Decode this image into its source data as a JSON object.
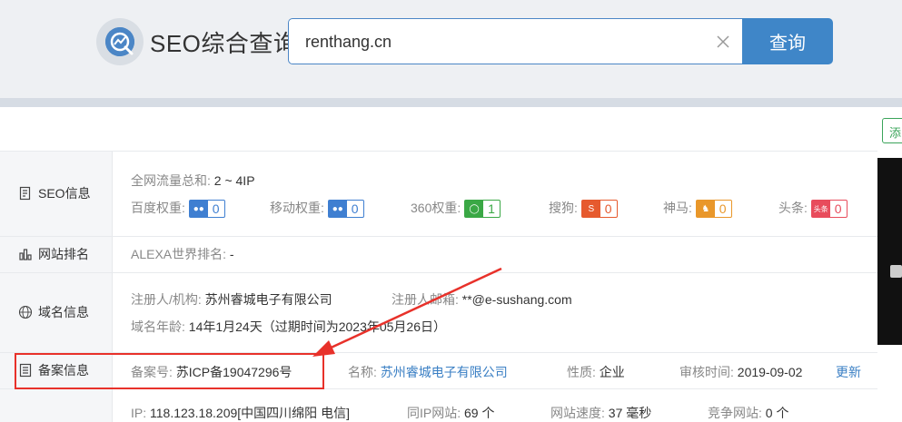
{
  "header": {
    "brand": "SEO综合查询",
    "search_value": "renthang.cn",
    "search_button": "查询"
  },
  "panel": {
    "add_label": "添"
  },
  "sidebar": {
    "seo": "SEO信息",
    "rank": "网站排名",
    "domain": "域名信息",
    "icp": "备案信息"
  },
  "seo": {
    "traffic_label": "全网流量总和:",
    "traffic_value": "2 ~ 4IP",
    "weights": [
      {
        "label": "百度权重:",
        "value": "0",
        "color": "#3f7fd1",
        "icon": "baidu-paw-icon"
      },
      {
        "label": "移动权重:",
        "value": "0",
        "color": "#3f7fd1",
        "icon": "mobile-paw-icon"
      },
      {
        "label": "360权重:",
        "value": "1",
        "color": "#3aa845",
        "icon": "360-icon"
      },
      {
        "label": "搜狗:",
        "value": "0",
        "color": "#e65a2e",
        "icon": "sogou-icon"
      },
      {
        "label": "神马:",
        "value": "0",
        "color": "#e9972a",
        "icon": "shenma-icon"
      },
      {
        "label": "头条:",
        "value": "0",
        "color": "#e84c5c",
        "icon": "toutiao-icon"
      }
    ],
    "toutiao_icon_text": "头条"
  },
  "rank": {
    "alexa_label": "ALEXA世界排名:",
    "alexa_value": "-"
  },
  "domain": {
    "registrant_label": "注册人/机构:",
    "registrant_value": "苏州睿城电子有限公司",
    "email_label": "注册人邮箱:",
    "email_value": "**@e-sushang.com",
    "age_label": "域名年龄:",
    "age_value": "14年1月24天（过期时间为2023年05月26日）"
  },
  "icp": {
    "number_label": "备案号:",
    "number_value": "苏ICP备19047296号",
    "name_label": "名称:",
    "name_value": "苏州睿城电子有限公司",
    "nature_label": "性质:",
    "nature_value": "企业",
    "review_label": "审核时间:",
    "review_value": "2019-09-02",
    "update_label": "更新"
  },
  "ip": {
    "ip_label": "IP:",
    "ip_value": "118.123.18.209[中国四川绵阳 电信]",
    "same_ip_label": "同IP网站:",
    "same_ip_value": "69 个",
    "speed_label": "网站速度:",
    "speed_value": "37 毫秒",
    "compete_label": "竞争网站:",
    "compete_value": "0 个"
  }
}
